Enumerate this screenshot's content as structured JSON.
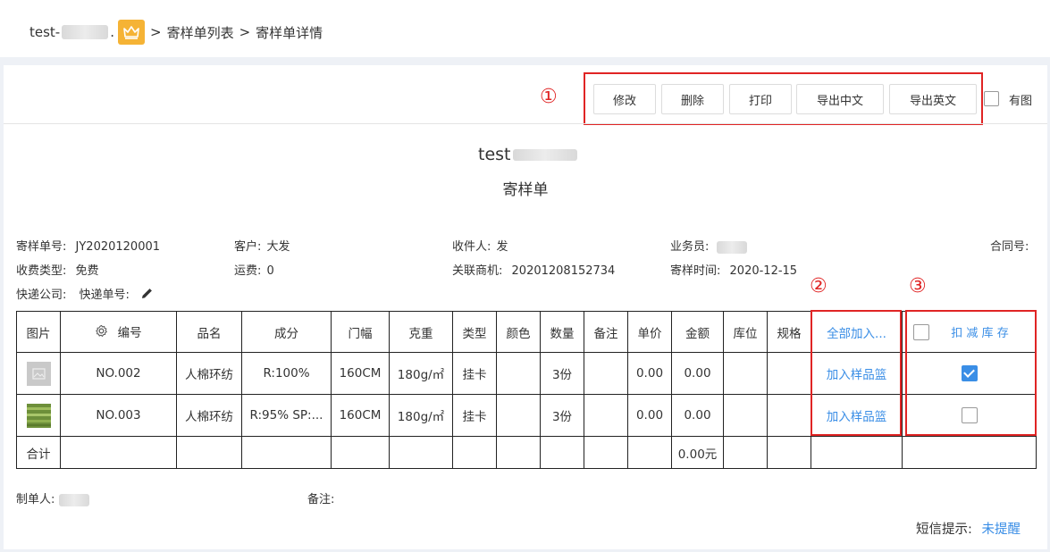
{
  "breadcrumb": {
    "company_prefix": "test-",
    "company_suffix": ".",
    "sep1": ">",
    "list_link": "寄样单列表",
    "sep2": ">",
    "current": "寄样单详情"
  },
  "toolbar": {
    "edit_label": "修改",
    "delete_label": "删除",
    "print_label": "打印",
    "export_cn_label": "导出中文",
    "export_en_label": "导出英文",
    "with_image_label": "有图",
    "with_image_checked": false
  },
  "annotations": {
    "one": "①",
    "two": "②",
    "three": "③"
  },
  "header": {
    "company": "test",
    "doc_title": "寄样单"
  },
  "info": {
    "sample_no_label": "寄样单号:",
    "sample_no": "JY2020120001",
    "customer_label": "客户:",
    "customer": "大发",
    "receiver_label": "收件人:",
    "receiver": "发",
    "salesman_label": "业务员:",
    "contract_label": "合同号:",
    "fee_type_label": "收费类型:",
    "fee_type": "免费",
    "freight_label": "运费:",
    "freight": "0",
    "opportunity_label": "关联商机:",
    "opportunity": "20201208152734",
    "send_time_label": "寄样时间:",
    "send_time": "2020-12-15",
    "courier_label": "快递公司:",
    "tracking_label": "快递单号:"
  },
  "table": {
    "headers": {
      "image": "图片",
      "number": "编号",
      "name": "品名",
      "composition": "成分",
      "width": "门幅",
      "weight": "克重",
      "type": "类型",
      "color": "颜色",
      "quantity": "数量",
      "remark": "备注",
      "unit_price": "单价",
      "amount": "金额",
      "location": "库位",
      "spec": "规格",
      "add_all": "全部加入...",
      "deduct_stock": "扣 减 库 存"
    },
    "rows": [
      {
        "number": "NO.002",
        "name": "人棉环纺",
        "composition": "R:100%",
        "width": "160CM",
        "weight": "180g/㎡",
        "type": "挂卡",
        "color": "",
        "quantity": "3份",
        "remark": "",
        "unit_price": "0.00",
        "amount": "0.00",
        "location": "",
        "spec": "",
        "add_link": "加入样品篮",
        "deduct_checked": true
      },
      {
        "number": "NO.003",
        "name": "人棉环纺",
        "composition": "R:95% SP:...",
        "width": "160CM",
        "weight": "180g/㎡",
        "type": "挂卡",
        "color": "",
        "quantity": "3份",
        "remark": "",
        "unit_price": "0.00",
        "amount": "0.00",
        "location": "",
        "spec": "",
        "add_link": "加入样品篮",
        "deduct_checked": false
      }
    ],
    "total_label": "合计",
    "total_amount": "0.00元"
  },
  "footer": {
    "maker_label": "制单人:",
    "remark_label": "备注:",
    "sms_label": "短信提示:",
    "sms_status": "未提醒"
  },
  "colors": {
    "accent": "#3a8ee6",
    "annotation_red": "#e02424",
    "crown_bg": "#f5b335"
  }
}
